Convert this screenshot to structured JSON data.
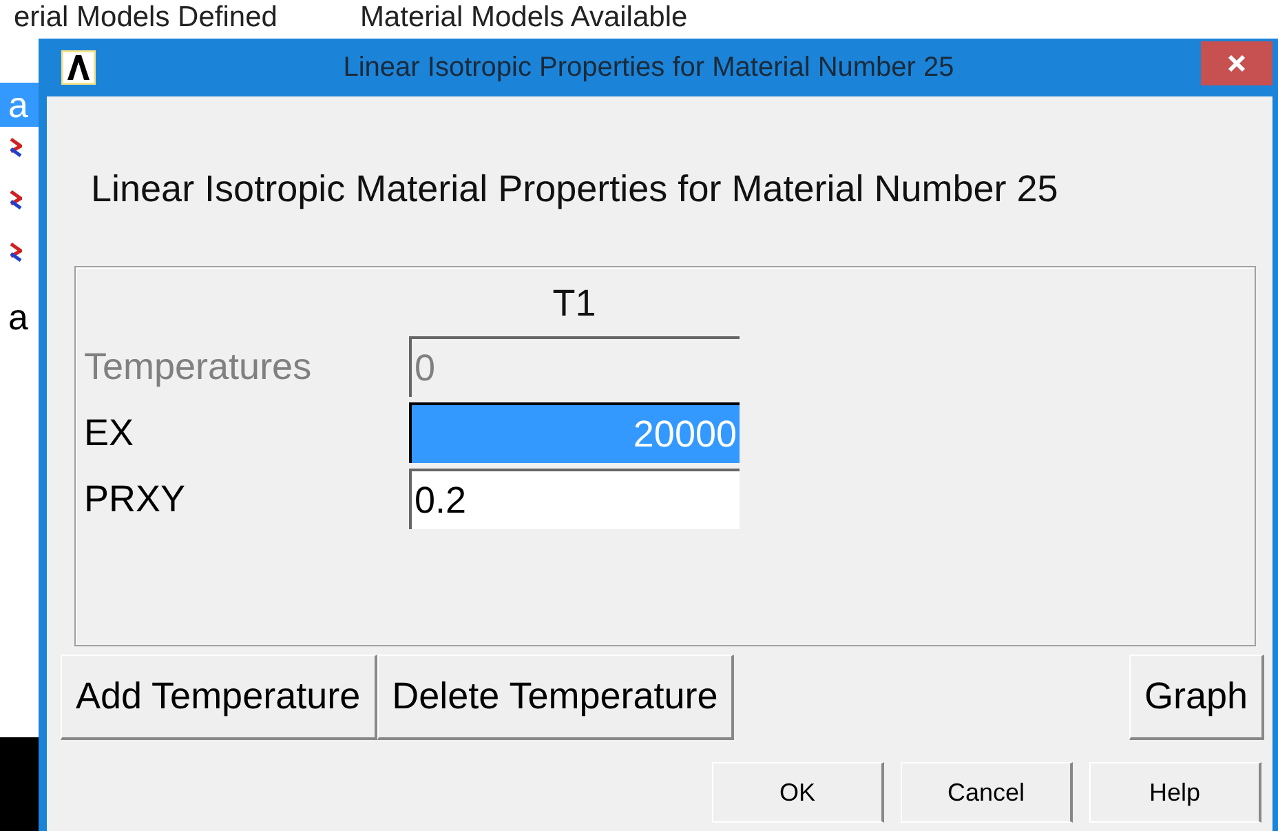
{
  "background": {
    "headings": [
      "erial Models Defined",
      "Material Models Available"
    ],
    "strip": [
      {
        "kind": "text",
        "text": "a",
        "selected": true
      },
      {
        "kind": "icon"
      },
      {
        "kind": "icon"
      },
      {
        "kind": "icon"
      },
      {
        "kind": "text",
        "text": "a",
        "selected": false
      }
    ]
  },
  "window": {
    "title": "Linear Isotropic Properties for Material Number 25"
  },
  "heading": "Linear Isotropic Material Properties for Material Number 25",
  "table": {
    "columns": [
      "T1"
    ],
    "rows": [
      {
        "label": "Temperatures",
        "value": "0",
        "disabled": true,
        "selected": false
      },
      {
        "label": "EX",
        "value": "20000",
        "disabled": false,
        "selected": true
      },
      {
        "label": "PRXY",
        "value": "0.2",
        "disabled": false,
        "selected": false
      }
    ]
  },
  "actions": [
    "Add Temperature",
    "Delete Temperature"
  ],
  "graph_button": "Graph",
  "buttons": [
    "OK",
    "Cancel",
    "Help"
  ]
}
